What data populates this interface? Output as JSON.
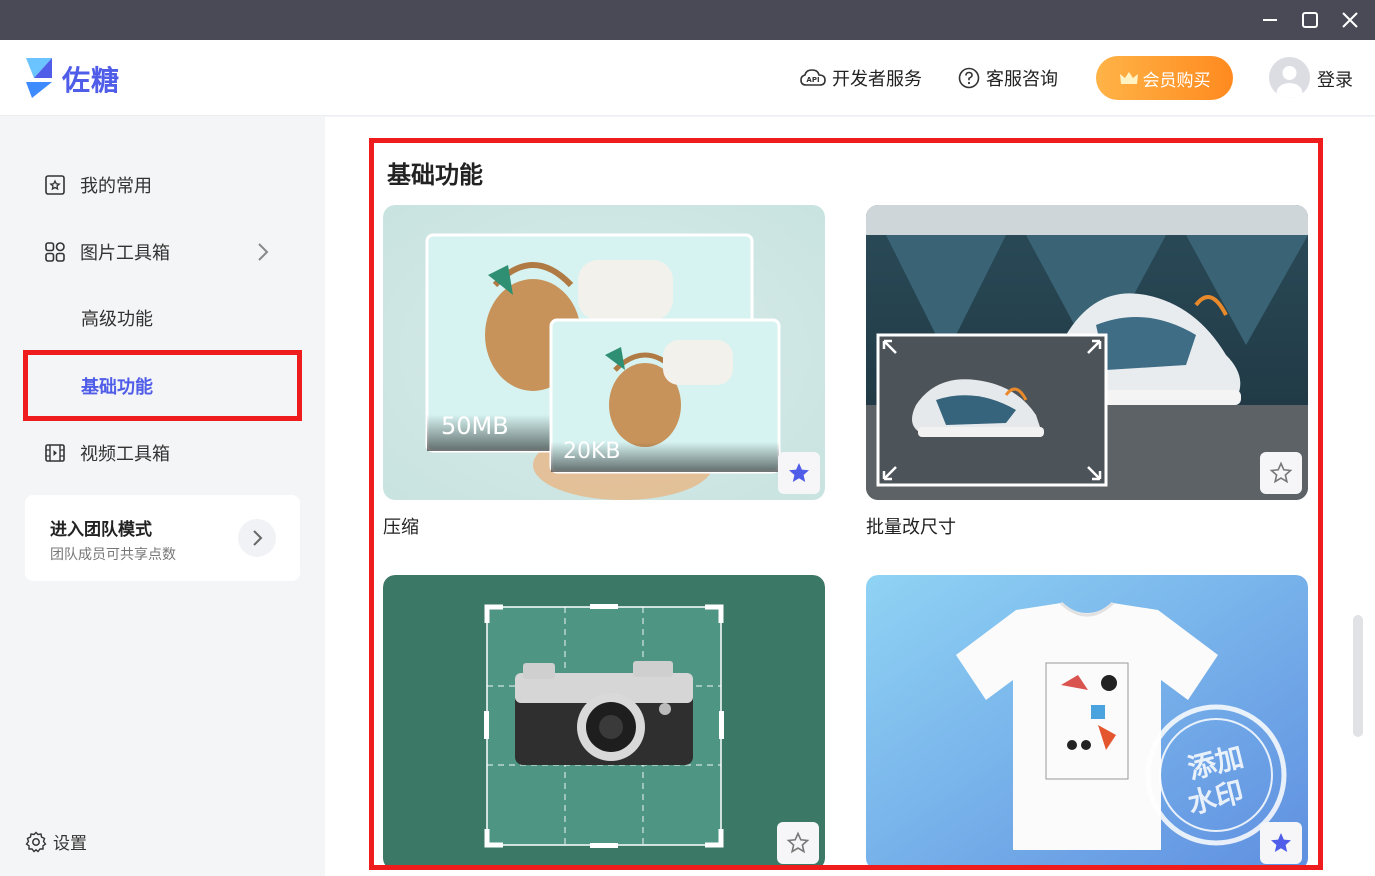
{
  "app": {
    "name": "佐糖",
    "brand_color": "#4f5de8",
    "accent_red": "#ee1c1c"
  },
  "header": {
    "dev_label": "开发者服务",
    "support_label": "客服咨询",
    "vip_label": "会员购买",
    "login_label": "登录"
  },
  "sidebar": {
    "items": [
      {
        "label": "我的常用",
        "icon": "favorite-photo-icon"
      },
      {
        "label": "图片工具箱",
        "icon": "grid-apps-icon"
      },
      {
        "label": "高级功能"
      },
      {
        "label": "基础功能",
        "active": true
      },
      {
        "label": "视频工具箱",
        "icon": "film-icon"
      }
    ],
    "team": {
      "title": "进入团队模式",
      "subtitle": "团队成员可共享点数"
    },
    "settings_label": "设置"
  },
  "main": {
    "section_title": "基础功能",
    "cards": [
      {
        "label": "压缩",
        "size_before": "50MB",
        "size_after": "20KB",
        "favorited": true
      },
      {
        "label": "批量改尺寸",
        "favorited": false
      },
      {
        "label": "",
        "favorited": false
      },
      {
        "label": "",
        "stamp_text_1": "添加",
        "stamp_text_2": "水印",
        "favorited": true
      }
    ]
  }
}
